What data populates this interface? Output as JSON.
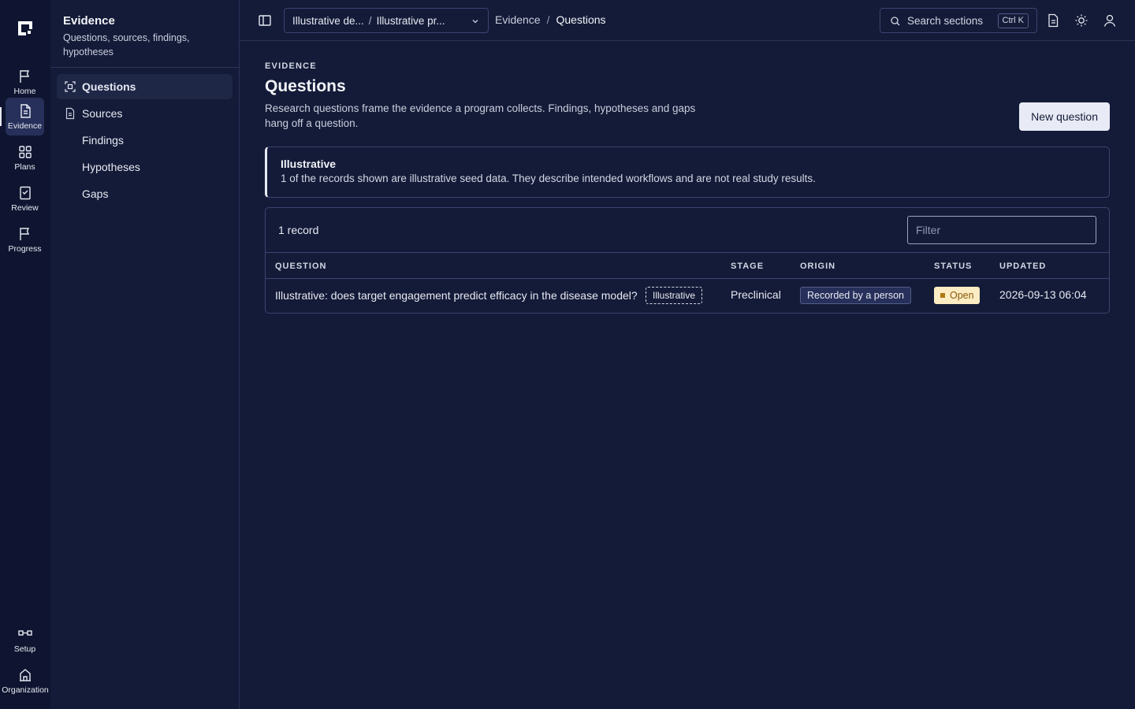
{
  "rail": {
    "items": [
      {
        "label": "Home",
        "icon": "flag-icon"
      },
      {
        "label": "Evidence",
        "icon": "document-icon",
        "active": true
      },
      {
        "label": "Plans",
        "icon": "grid-icon"
      },
      {
        "label": "Review",
        "icon": "checklist-icon"
      },
      {
        "label": "Progress",
        "icon": "flag-icon"
      }
    ],
    "bottom_items": [
      {
        "label": "Setup",
        "icon": "pipeline-icon"
      },
      {
        "label": "Organization",
        "icon": "building-icon"
      }
    ]
  },
  "sidebar": {
    "title": "Evidence",
    "subtitle": "Questions, sources, findings, hypotheses",
    "items": [
      {
        "label": "Questions",
        "active": true,
        "icon": "question-scan-icon"
      },
      {
        "label": "Sources",
        "icon": "document-icon"
      },
      {
        "label": "Findings"
      },
      {
        "label": "Hypotheses"
      },
      {
        "label": "Gaps"
      }
    ]
  },
  "topbar": {
    "context_left": "Illustrative de...",
    "context_sep": "/",
    "context_right": "Illustrative pr...",
    "breadcrumb": [
      "Evidence",
      "Questions"
    ],
    "breadcrumb_sep": "/",
    "search_label": "Search sections",
    "search_shortcut": "Ctrl K"
  },
  "page": {
    "eyebrow": "EVIDENCE",
    "title": "Questions",
    "description": "Research questions frame the evidence a program collects. Findings, hypotheses and gaps hang off a question.",
    "new_button": "New question"
  },
  "notice": {
    "title": "Illustrative",
    "body": "1 of the records shown are illustrative seed data. They describe intended workflows and are not real study results."
  },
  "table": {
    "record_count": "1 record",
    "filter_placeholder": "Filter",
    "columns": {
      "question": "QUESTION",
      "stage": "STAGE",
      "origin": "ORIGIN",
      "status": "STATUS",
      "updated": "UPDATED"
    },
    "rows": [
      {
        "question": "Illustrative: does target engagement predict efficacy in the disease model?",
        "tag": "Illustrative",
        "stage": "Preclinical",
        "origin": "Recorded by a person",
        "status": "Open",
        "updated": "2026-09-13 06:04"
      }
    ]
  },
  "colors": {
    "background": "#141b38",
    "rail": "#0f1530",
    "status_open_bg": "#fbecc4",
    "status_open_text": "#8a5a0c"
  }
}
